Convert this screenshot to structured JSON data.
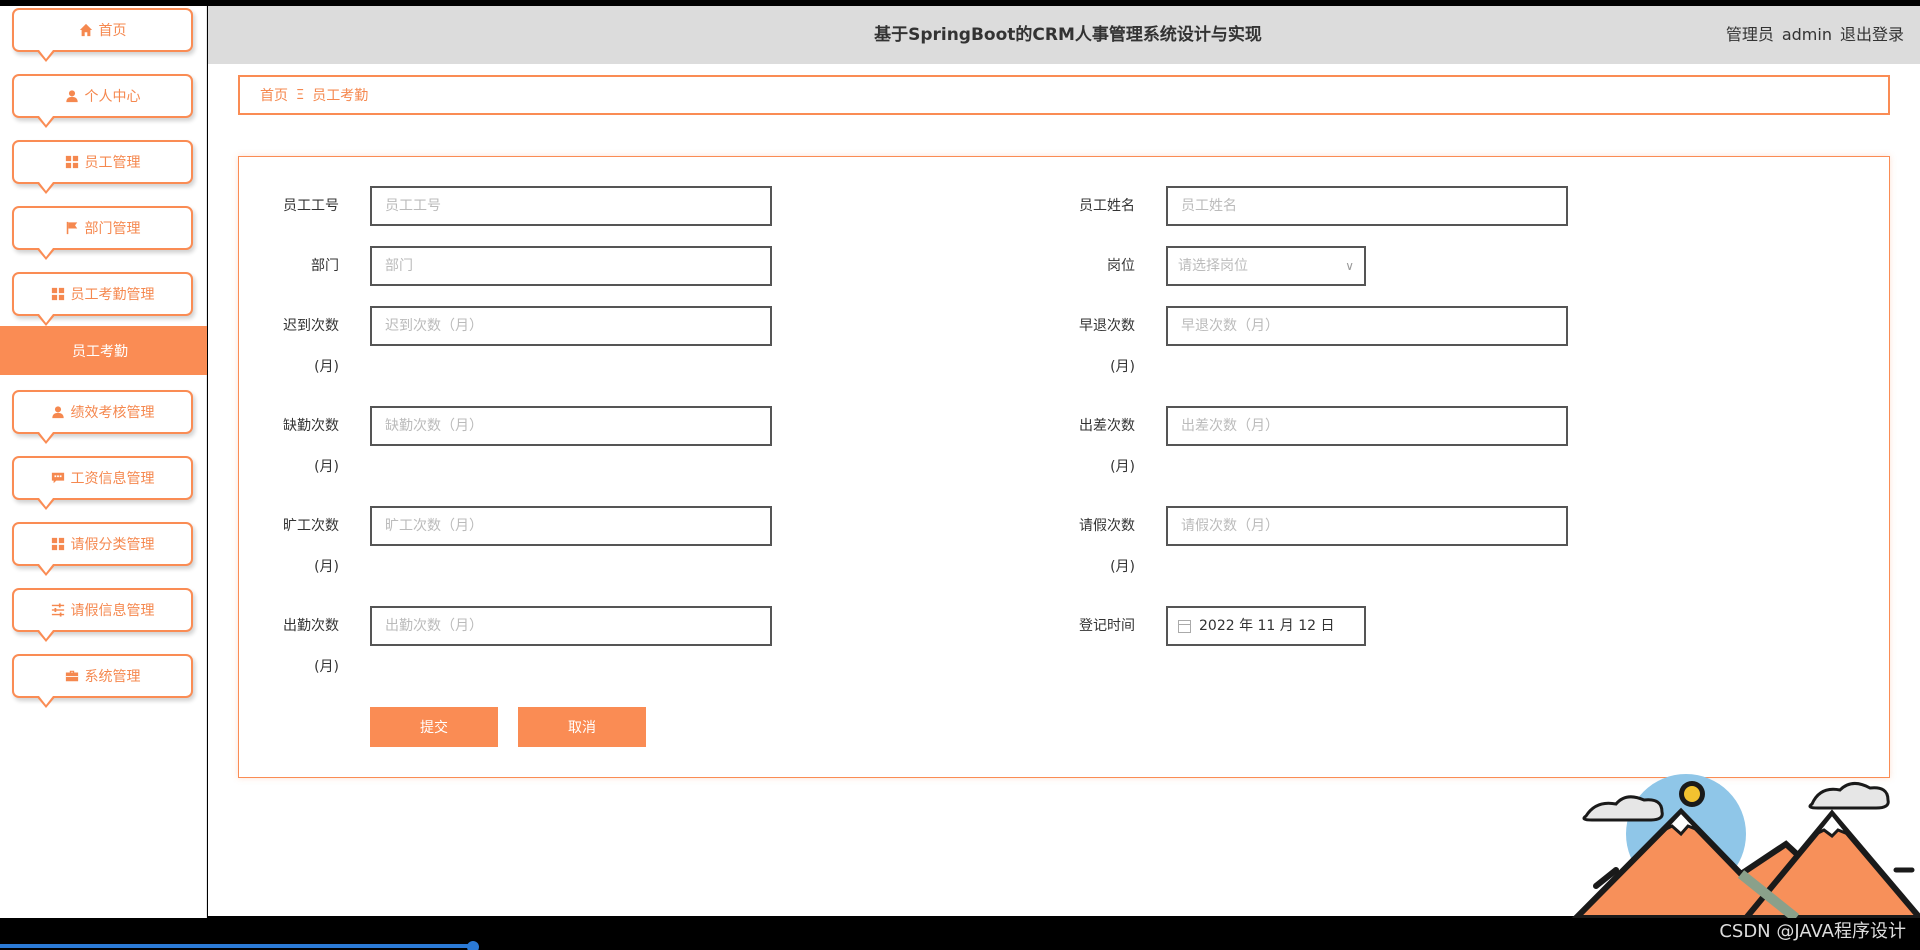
{
  "sidebar": {
    "items": [
      {
        "label": "首页",
        "icon": "home-icon"
      },
      {
        "label": "个人中心",
        "icon": "user-icon"
      },
      {
        "label": "员工管理",
        "icon": "grid-icon"
      },
      {
        "label": "部门管理",
        "icon": "flag-icon"
      },
      {
        "label": "员工考勤管理",
        "icon": "grid-icon"
      },
      {
        "label": "绩效考核管理",
        "icon": "user-icon"
      },
      {
        "label": "工资信息管理",
        "icon": "chat-icon"
      },
      {
        "label": "请假分类管理",
        "icon": "grid-icon"
      },
      {
        "label": "请假信息管理",
        "icon": "sliders-icon"
      },
      {
        "label": "系统管理",
        "icon": "briefcase-icon"
      }
    ],
    "active_submenu": "员工考勤"
  },
  "header": {
    "title": "基于SpringBoot的CRM人事管理系统设计与实现",
    "role": "管理员",
    "username": "admin",
    "logout": "退出登录"
  },
  "breadcrumb": {
    "home": "首页",
    "separator": "Ξ",
    "current": "员工考勤"
  },
  "form": {
    "emp_no": {
      "label": "员工工号",
      "placeholder": "员工工号"
    },
    "emp_name": {
      "label": "员工姓名",
      "placeholder": "员工姓名"
    },
    "department": {
      "label": "部门",
      "placeholder": "部门"
    },
    "position": {
      "label": "岗位",
      "placeholder": "请选择岗位"
    },
    "late": {
      "label": "迟到次数",
      "label_unit": "(月)",
      "placeholder": "迟到次数（月）"
    },
    "early": {
      "label": "早退次数",
      "label_unit": "(月)",
      "placeholder": "早退次数（月）"
    },
    "absent": {
      "label": "缺勤次数",
      "label_unit": "(月)",
      "placeholder": "缺勤次数（月）"
    },
    "trip": {
      "label": "出差次数",
      "label_unit": "(月)",
      "placeholder": "出差次数（月）"
    },
    "truancy": {
      "label": "旷工次数",
      "label_unit": "(月)",
      "placeholder": "旷工次数（月）"
    },
    "leave": {
      "label": "请假次数",
      "label_unit": "(月)",
      "placeholder": "请假次数（月）"
    },
    "attendance": {
      "label": "出勤次数",
      "label_unit": "(月)",
      "placeholder": "出勤次数（月）"
    },
    "register_time": {
      "label": "登记时间",
      "value": "2022 年 11 月 12 日"
    },
    "submit": "提交",
    "cancel": "取消"
  },
  "watermark": "CSDN @JAVA程序设计",
  "colors": {
    "accent": "#fa8c54",
    "header_bg": "#dcdcdc"
  }
}
